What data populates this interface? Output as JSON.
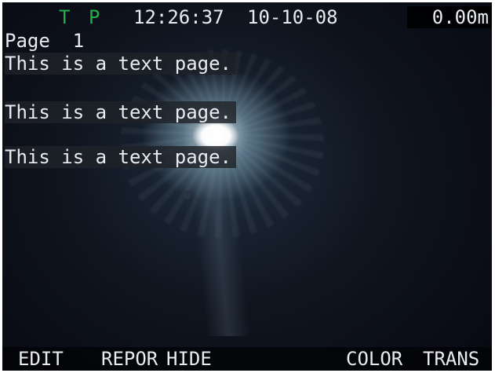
{
  "status": {
    "indicator_t": "T",
    "indicator_p": "P",
    "time": "12:26:37",
    "date": "10-10-08",
    "distance": "0.00m",
    "indicator_color": "#22b04a"
  },
  "page": {
    "label": "Page  1"
  },
  "text_lines": [
    "This is a text page.",
    "This is a text page.",
    "This is a text page."
  ],
  "soft_keys": {
    "edit": "EDIT",
    "repor": "REPOR",
    "hide": "HIDE",
    "color": "COLOR",
    "trans": "TRANS"
  }
}
